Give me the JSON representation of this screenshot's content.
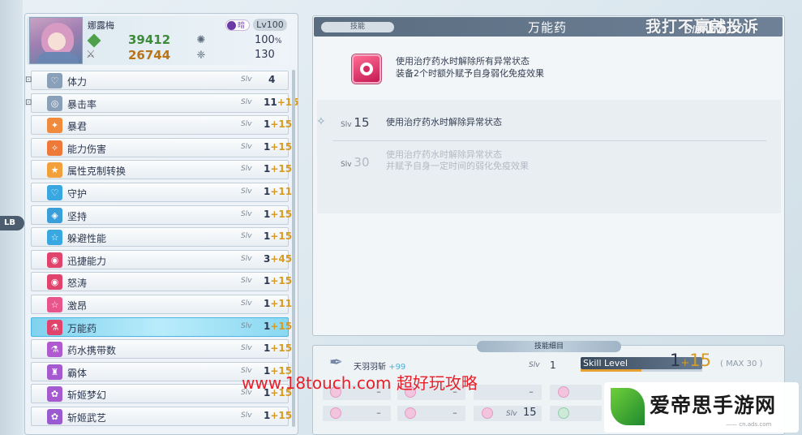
{
  "side": {
    "lb_label": "LB"
  },
  "character": {
    "name": "娜露梅",
    "element_label": "暗",
    "level": "Lv100",
    "hp": "39412",
    "atk": "26744",
    "stat1": "100",
    "stat1_unit": "%",
    "stat2": "130"
  },
  "skills": [
    {
      "name": "体力",
      "slv": "Slv",
      "base": "4",
      "plus": "",
      "locked": true,
      "color": "#8aa0b8",
      "icon": "♡"
    },
    {
      "name": "暴击率",
      "slv": "Slv",
      "base": "11",
      "plus": "+15",
      "locked": true,
      "color": "#8aa0b8",
      "icon": "◎"
    },
    {
      "name": "暴君",
      "slv": "Slv",
      "base": "1",
      "plus": "+15",
      "locked": false,
      "color": "#f08a3c",
      "icon": "✦"
    },
    {
      "name": "能力伤害",
      "slv": "Slv",
      "base": "1",
      "plus": "+15",
      "locked": false,
      "color": "#ee7a3a",
      "icon": "✧"
    },
    {
      "name": "属性克制转换",
      "slv": "Slv",
      "base": "1",
      "plus": "+15",
      "locked": false,
      "color": "#f2a03c",
      "icon": "★"
    },
    {
      "name": "守护",
      "slv": "Slv",
      "base": "1",
      "plus": "+11",
      "locked": false,
      "color": "#3aa8e0",
      "icon": "♡"
    },
    {
      "name": "坚持",
      "slv": "Slv",
      "base": "1",
      "plus": "+15",
      "locked": false,
      "color": "#3a9ed8",
      "icon": "◈"
    },
    {
      "name": "躲避性能",
      "slv": "Slv",
      "base": "1",
      "plus": "+15",
      "locked": false,
      "color": "#3aa8e0",
      "icon": "☆"
    },
    {
      "name": "迅捷能力",
      "slv": "Slv",
      "base": "3",
      "plus": "+45",
      "locked": false,
      "color": "#e0436b",
      "icon": "◉"
    },
    {
      "name": "怒涛",
      "slv": "Slv",
      "base": "1",
      "plus": "+15",
      "locked": false,
      "color": "#e0436b",
      "icon": "◉"
    },
    {
      "name": "激昂",
      "slv": "Slv",
      "base": "1",
      "plus": "+11",
      "locked": false,
      "color": "#e8558a",
      "icon": "☆"
    },
    {
      "name": "万能药",
      "slv": "Slv",
      "base": "1",
      "plus": "+15",
      "locked": false,
      "color": "#e0436b",
      "icon": "⚗",
      "selected": true
    },
    {
      "name": "药水携带数",
      "slv": "Slv",
      "base": "1",
      "plus": "+15",
      "locked": false,
      "color": "#b05ad0",
      "icon": "⚗"
    },
    {
      "name": "霸体",
      "slv": "Slv",
      "base": "1",
      "plus": "+15",
      "locked": false,
      "color": "#a65ad0",
      "icon": "♜"
    },
    {
      "name": "斩姬梦幻",
      "slv": "Slv",
      "base": "1",
      "plus": "+15",
      "locked": false,
      "color": "#a65ad0",
      "icon": "✿"
    },
    {
      "name": "斩姬武艺",
      "slv": "Slv",
      "base": "1",
      "plus": "+15",
      "locked": false,
      "color": "#9a5ad0",
      "icon": "✿"
    }
  ],
  "detail": {
    "tag": "技能",
    "title": "万能药",
    "slv_prefix": "Slv",
    "slv_value": "15",
    "slv_max": "/30",
    "desc_line1": "使用治疗药水时解除所有异常状态",
    "desc_line2": "装备2个时额外赋予自身弱化免疫效果",
    "levels": [
      {
        "prefix": "Slv",
        "num": "15",
        "line1": "使用治疗药水时解除异常状态",
        "line2": ""
      },
      {
        "prefix": "Slv",
        "num": "30",
        "line1": "使用治疗药水时解除异常状态",
        "line2": "并赋予自身一定时间的弱化免疫效果"
      }
    ]
  },
  "bottom": {
    "header": "技能细目",
    "item_name": "天羽羽斩",
    "item_plus": "+99",
    "item_slv_label": "Slv",
    "item_slv": "1",
    "skill_level_label": "Skill Level",
    "gauge_fill": 0.5,
    "skill_base": "1",
    "skill_plus_sign": "+",
    "skill_plus": "15",
    "max_label": "( MAX 30 )",
    "cells_row1": [
      "–",
      "–",
      "–",
      ""
    ],
    "cells_row2": [
      "–",
      "–",
      "Slv",
      "15"
    ]
  },
  "watermarks": {
    "top": "我打不赢就投诉",
    "url": "www.18touch.com 超好玩攻略",
    "logo": "爱帝思手游网",
    "logo_sub": "—— cn.ads.com"
  }
}
